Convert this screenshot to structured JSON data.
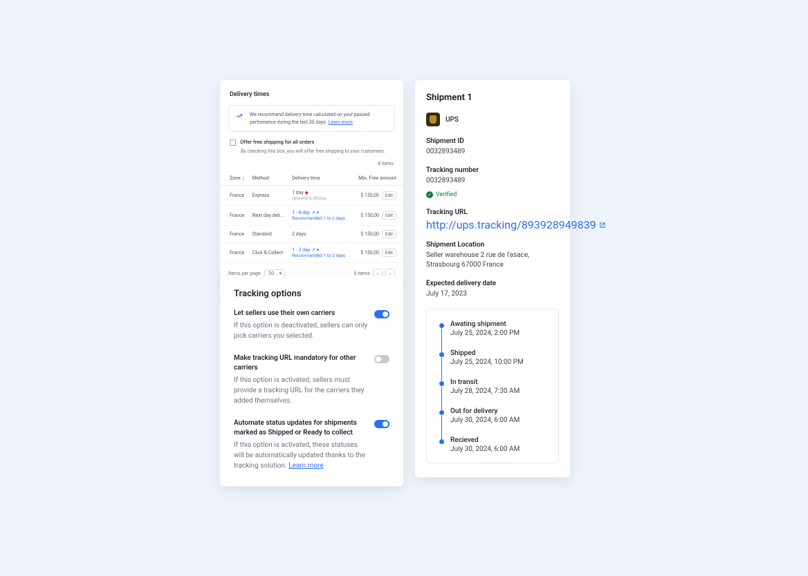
{
  "delivery": {
    "title": "Delivery times",
    "reco_text": "We recommend delivery time calculated on your passed perfomance during the last 30 days.",
    "reco_link": "Learn more",
    "free_label": "Offer free shipping for all orders",
    "free_sub": "By checking this box, you will offer free shipping to your customers.",
    "count": "4 items",
    "cols": {
      "zone": "Zone",
      "method": "Method",
      "time": "Delivery time",
      "min": "Min. Free amount"
    },
    "rows": [
      {
        "zone": "France",
        "method": "Express",
        "time": "1 day",
        "time_sub": "operator's choice",
        "warn": true,
        "amount": "$ 150,00"
      },
      {
        "zone": "France",
        "method": "Next day deli...",
        "time": "1 - 4 day",
        "time_sub": "Recommended 1 to 2 days",
        "link": true,
        "amount": "$ 150,00"
      },
      {
        "zone": "France",
        "method": "Standard",
        "time": "2 days",
        "amount": "$ 150,00"
      },
      {
        "zone": "France",
        "method": "Click & Collect",
        "time": "1 - 3 day",
        "time_sub": "Recommended 1 to 2 days",
        "link": true,
        "amount": "$ 150,00"
      }
    ],
    "edit": "Edit",
    "perpage_label": "Items per page",
    "perpage_value": "50",
    "page_count": "6 items"
  },
  "tracking": {
    "title": "Tracking options",
    "opts": [
      {
        "title": "Let sellers use their own carriers",
        "desc": "If this option is deactivated, sellers can only pick carriers you selected.",
        "on": true
      },
      {
        "title": "Make tracking URL mandatory for other carriers",
        "desc": "If this option is activated, sellers must provide a tracking URL for the carriers they  added themselves.",
        "on": false
      },
      {
        "title": "Automate status updates for shipments marked as Shipped or Ready to collect",
        "desc": "If this option is activated, these statuses will be automatically updated thanks to the tracking solution.",
        "link": "Learn more",
        "on": true
      }
    ]
  },
  "shipment": {
    "title": "Shipment 1",
    "carrier": "UPS",
    "fields": {
      "shipment_id": {
        "label": "Shipment ID",
        "value": "0032893489"
      },
      "tracking_number": {
        "label": "Tracking number",
        "value": "0032893489",
        "verified": "Verified"
      },
      "tracking_url": {
        "label": "Tracking URL",
        "value": "http://ups.tracking/893928949839"
      },
      "location": {
        "label": "Shipment Location",
        "value": "Seller warehouse 2 rue de l'asace, Strasbourg 67000 France"
      },
      "expected": {
        "label": "Expected delivery date",
        "value": "July 17, 2023"
      }
    },
    "timeline": [
      {
        "title": "Awating shipment",
        "date": "July 25, 2024, 2:00 PM"
      },
      {
        "title": "Shipped",
        "date": "July 25, 2024, 10:00 PM"
      },
      {
        "title": "In transit",
        "date": "July 28, 2024, 7:30 AM"
      },
      {
        "title": "Out for delivery",
        "date": "July 30, 2024, 6:00 AM"
      },
      {
        "title": "Recieved",
        "date": "July 30, 2024, 6:00 AM"
      }
    ]
  }
}
